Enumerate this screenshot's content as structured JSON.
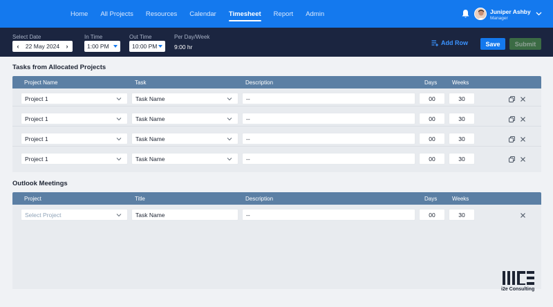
{
  "nav": {
    "links": [
      "Home",
      "All Projects",
      "Resources",
      "Calendar",
      "Timesheet",
      "Report",
      "Admin"
    ],
    "active": "Timesheet"
  },
  "user": {
    "name": "Juniper Ashby",
    "role": "Manager"
  },
  "toolbar": {
    "select_date_label": "Select Date",
    "date_value": "22 May 2024",
    "in_time_label": "In Time",
    "in_time_value": "1:00 PM",
    "out_time_label": "Out Time",
    "out_time_value": "10:00 PM",
    "per_day_label": "Per Day/Week",
    "per_day_value": "9:00 hr",
    "add_row_label": "Add Row",
    "save_label": "Save",
    "submit_label": "Submit"
  },
  "tasks_section": {
    "title": "Tasks from Allocated Projects",
    "columns": {
      "project": "Project Name",
      "task": "Task",
      "description": "Description",
      "days": "Days",
      "weeks": "Weeks"
    },
    "rows": [
      {
        "project": "Project 1",
        "task": "Task Name",
        "description": "--",
        "days": "00",
        "weeks": "30"
      },
      {
        "project": "Project 1",
        "task": "Task Name",
        "description": "--",
        "days": "00",
        "weeks": "30"
      },
      {
        "project": "Project 1",
        "task": "Task Name",
        "description": "--",
        "days": "00",
        "weeks": "30"
      },
      {
        "project": "Project 1",
        "task": "Task Name",
        "description": "--",
        "days": "00",
        "weeks": "30"
      }
    ]
  },
  "meetings_section": {
    "title": "Outlook Meetings",
    "columns": {
      "project": "Project",
      "title": "Title",
      "description": "Description",
      "days": "Days",
      "weeks": "Weeks"
    },
    "rows": [
      {
        "project_placeholder": "Select Project",
        "title": "Task Name",
        "description": "--",
        "days": "00",
        "weeks": "30"
      }
    ]
  },
  "branding": {
    "logo_text": "i2e Consulting"
  },
  "colors": {
    "nav_bg": "#1479ee",
    "toolbar_bg": "#1b2540",
    "table_head_bg": "#5b7fa4",
    "submit_bg": "#3b6b44"
  }
}
